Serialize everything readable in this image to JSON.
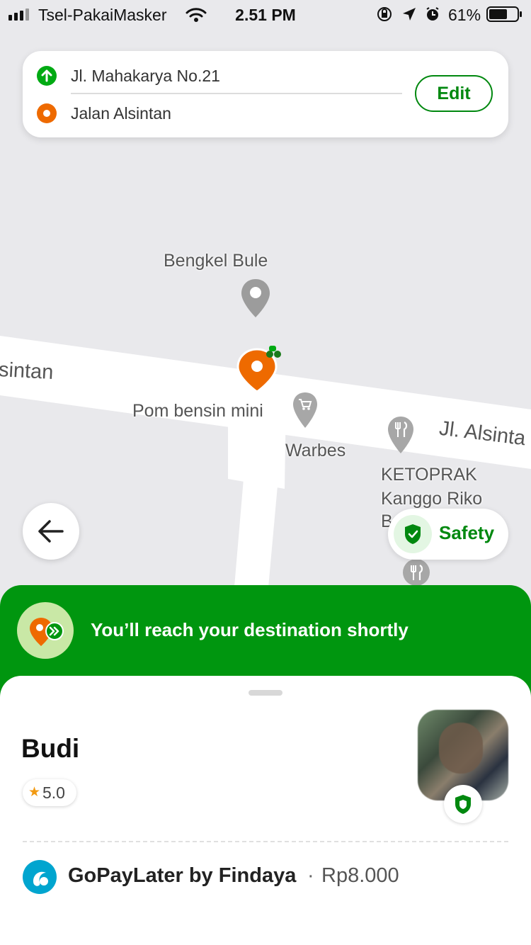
{
  "status_bar": {
    "carrier": "Tsel-PakaiMasker",
    "time": "2.51 PM",
    "battery": "61%"
  },
  "route": {
    "pickup": "Jl. Mahakarya No.21",
    "destination": "Jalan Alsintan",
    "edit_label": "Edit"
  },
  "map": {
    "labels": {
      "bengkel": "Bengkel Bule",
      "road_left": "sintan",
      "pom": "Pom bensin mini",
      "warbes": "Warbes",
      "road_right": "Jl. Alsinta",
      "ketoprak_1": "KETOPRAK",
      "ketoprak_2": "Kanggo Riko",
      "ketoprak_3": "B"
    }
  },
  "safety": {
    "label": "Safety"
  },
  "banner": {
    "text": "You’ll reach your destination shortly"
  },
  "driver": {
    "name": "Budi",
    "rating": "5.0"
  },
  "payment": {
    "method": "GoPayLater by Findaya",
    "separator": "·",
    "amount": "Rp8.000"
  },
  "colors": {
    "brand_green": "#00960f",
    "accent_orange": "#ee6a00",
    "pay_blue": "#00a5cf"
  }
}
